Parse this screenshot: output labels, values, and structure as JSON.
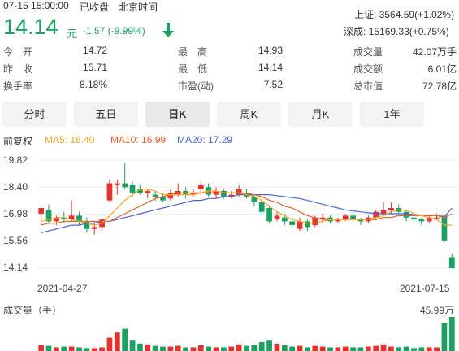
{
  "header": {
    "datetime": "07-15 15:00:00",
    "status": "已收盘",
    "timezone": "北京时间",
    "price": "14.14",
    "currency": "元",
    "change": "-1.57 (-9.99%)",
    "direction_icon": "arrow-down-icon"
  },
  "indices": [
    {
      "label": "上证:",
      "value": "3564.59(+1.02%)"
    },
    {
      "label": "深成:",
      "value": "15169.33(+0.75%)"
    }
  ],
  "stats": {
    "col1": [
      {
        "label": "今　开",
        "value": "14.72"
      },
      {
        "label": "昨　收",
        "value": "15.71"
      },
      {
        "label": "换手率",
        "value": "8.18%"
      }
    ],
    "col2": [
      {
        "label": "最　高",
        "value": "14.93"
      },
      {
        "label": "最　低",
        "value": "14.14"
      },
      {
        "label": "市盈(动)",
        "value": "7.52"
      }
    ],
    "col3": [
      {
        "label": "成交量",
        "value": "42.07万手"
      },
      {
        "label": "成交额",
        "value": "6.01亿"
      },
      {
        "label": "总市值",
        "value": "72.78亿"
      }
    ]
  },
  "tabs": [
    "分时",
    "五日",
    "日K",
    "周K",
    "月K",
    "1年"
  ],
  "active_tab": "日K",
  "ma_bar": {
    "adjust": "前复权",
    "ma5": "MA5: 16.40",
    "ma10": "MA10: 16.99",
    "ma20": "MA20: 17.29"
  },
  "colors": {
    "up": "#e5322d",
    "down": "#1aa260",
    "ma5": "#f5a623",
    "ma10": "#e8622b",
    "ma20": "#4a63d8"
  },
  "volume_label": "成交量（手）",
  "volume_max_label": "45.99万",
  "chart_data": {
    "type": "candlestick",
    "y_ticks": [
      "19.82",
      "18.40",
      "16.98",
      "15.56",
      "14.14"
    ],
    "x_labels": [
      "2021-04-27",
      "2021-07-15"
    ],
    "ylim": [
      14.14,
      19.82
    ],
    "candles": [
      {
        "o": 17.0,
        "c": 17.3,
        "h": 17.4,
        "l": 16.4
      },
      {
        "o": 17.2,
        "c": 16.6,
        "h": 17.5,
        "l": 16.5
      },
      {
        "o": 16.6,
        "c": 16.8,
        "h": 16.9,
        "l": 16.4
      },
      {
        "o": 16.8,
        "c": 16.7,
        "h": 17.1,
        "l": 16.5
      },
      {
        "o": 16.7,
        "c": 16.9,
        "h": 17.7,
        "l": 16.6
      },
      {
        "o": 16.9,
        "c": 16.6,
        "h": 17.1,
        "l": 16.4
      },
      {
        "o": 16.6,
        "c": 16.2,
        "h": 16.8,
        "l": 16.0
      },
      {
        "o": 16.2,
        "c": 16.3,
        "h": 16.6,
        "l": 15.9
      },
      {
        "o": 16.3,
        "c": 16.7,
        "h": 16.8,
        "l": 16.1
      },
      {
        "o": 17.7,
        "c": 18.6,
        "h": 18.8,
        "l": 17.6
      },
      {
        "o": 18.5,
        "c": 18.6,
        "h": 18.8,
        "l": 18.0
      },
      {
        "o": 18.6,
        "c": 18.4,
        "h": 19.7,
        "l": 18.3
      },
      {
        "o": 18.5,
        "c": 18.1,
        "h": 18.7,
        "l": 17.9
      },
      {
        "o": 18.3,
        "c": 18.1,
        "h": 18.5,
        "l": 18.0
      },
      {
        "o": 18.1,
        "c": 18.2,
        "h": 18.3,
        "l": 17.8
      },
      {
        "o": 18.0,
        "c": 17.9,
        "h": 18.2,
        "l": 17.7
      },
      {
        "o": 17.9,
        "c": 17.7,
        "h": 18.1,
        "l": 17.6
      },
      {
        "o": 17.8,
        "c": 18.1,
        "h": 18.3,
        "l": 17.7
      },
      {
        "o": 18.0,
        "c": 18.2,
        "h": 18.6,
        "l": 17.9
      },
      {
        "o": 18.2,
        "c": 18.0,
        "h": 18.4,
        "l": 17.8
      },
      {
        "o": 18.0,
        "c": 18.1,
        "h": 18.3,
        "l": 17.9
      },
      {
        "o": 18.3,
        "c": 18.5,
        "h": 18.7,
        "l": 18.0
      },
      {
        "o": 18.4,
        "c": 18.0,
        "h": 18.6,
        "l": 17.9
      },
      {
        "o": 18.0,
        "c": 18.2,
        "h": 18.4,
        "l": 17.8
      },
      {
        "o": 18.2,
        "c": 17.9,
        "h": 18.3,
        "l": 17.8
      },
      {
        "o": 17.9,
        "c": 18.0,
        "h": 18.2,
        "l": 17.8
      },
      {
        "o": 18.0,
        "c": 18.3,
        "h": 18.5,
        "l": 17.9
      },
      {
        "o": 18.1,
        "c": 17.9,
        "h": 18.3,
        "l": 17.8
      },
      {
        "o": 17.9,
        "c": 17.6,
        "h": 18.0,
        "l": 17.4
      },
      {
        "o": 17.6,
        "c": 17.1,
        "h": 17.8,
        "l": 17.0
      },
      {
        "o": 17.3,
        "c": 16.6,
        "h": 17.4,
        "l": 16.5
      },
      {
        "o": 16.7,
        "c": 16.9,
        "h": 17.1,
        "l": 16.6
      },
      {
        "o": 16.8,
        "c": 16.6,
        "h": 17.0,
        "l": 16.4
      },
      {
        "o": 16.6,
        "c": 16.4,
        "h": 16.8,
        "l": 16.3
      },
      {
        "o": 16.2,
        "c": 16.6,
        "h": 16.8,
        "l": 16.1
      },
      {
        "o": 16.6,
        "c": 16.3,
        "h": 16.7,
        "l": 16.1
      },
      {
        "o": 16.4,
        "c": 16.8,
        "h": 16.9,
        "l": 16.3
      },
      {
        "o": 16.7,
        "c": 16.8,
        "h": 17.0,
        "l": 16.5
      },
      {
        "o": 16.8,
        "c": 16.6,
        "h": 16.9,
        "l": 16.5
      },
      {
        "o": 16.6,
        "c": 16.7,
        "h": 16.8,
        "l": 16.5
      },
      {
        "o": 16.7,
        "c": 16.9,
        "h": 17.0,
        "l": 16.6
      },
      {
        "o": 16.9,
        "c": 16.7,
        "h": 17.1,
        "l": 16.6
      },
      {
        "o": 16.7,
        "c": 16.6,
        "h": 16.8,
        "l": 16.4
      },
      {
        "o": 16.6,
        "c": 16.8,
        "h": 16.9,
        "l": 16.5
      },
      {
        "o": 16.8,
        "c": 17.1,
        "h": 17.2,
        "l": 16.7
      },
      {
        "o": 17.0,
        "c": 17.2,
        "h": 17.6,
        "l": 16.9
      },
      {
        "o": 17.2,
        "c": 17.3,
        "h": 17.6,
        "l": 17.0
      },
      {
        "o": 17.3,
        "c": 17.1,
        "h": 17.5,
        "l": 17.0
      },
      {
        "o": 17.1,
        "c": 16.8,
        "h": 17.2,
        "l": 16.6
      },
      {
        "o": 16.8,
        "c": 16.7,
        "h": 16.9,
        "l": 16.6
      },
      {
        "o": 16.7,
        "c": 16.6,
        "h": 16.8,
        "l": 16.4
      },
      {
        "o": 16.6,
        "c": 16.8,
        "h": 16.9,
        "l": 16.5
      },
      {
        "o": 16.8,
        "c": 16.8,
        "h": 17.0,
        "l": 16.7
      },
      {
        "o": 16.9,
        "c": 15.6,
        "h": 15.8,
        "l": 15.5
      },
      {
        "o": 14.72,
        "c": 14.14,
        "h": 14.93,
        "l": 14.14
      }
    ],
    "ma5": [
      16.6,
      16.7,
      16.8,
      16.8,
      16.7,
      16.6,
      16.5,
      16.4,
      16.5,
      16.9,
      17.3,
      17.7,
      18.0,
      18.3,
      18.3,
      18.2,
      18.0,
      18.0,
      18.0,
      18.0,
      18.0,
      18.1,
      18.2,
      18.2,
      18.1,
      18.1,
      18.1,
      18.0,
      17.9,
      17.7,
      17.4,
      17.1,
      16.9,
      16.7,
      16.6,
      16.5,
      16.5,
      16.6,
      16.7,
      16.7,
      16.7,
      16.7,
      16.7,
      16.7,
      16.8,
      16.9,
      17.1,
      17.2,
      17.2,
      17.0,
      16.9,
      16.8,
      16.7,
      16.4,
      16.4
    ],
    "ma10": [
      16.4,
      16.5,
      16.5,
      16.6,
      16.6,
      16.6,
      16.6,
      16.6,
      16.6,
      16.6,
      16.8,
      17.0,
      17.2,
      17.4,
      17.6,
      17.8,
      17.9,
      18.0,
      18.1,
      18.1,
      18.1,
      18.1,
      18.1,
      18.1,
      18.1,
      18.1,
      18.1,
      18.1,
      18.0,
      17.9,
      17.7,
      17.6,
      17.4,
      17.3,
      17.1,
      16.9,
      16.8,
      16.7,
      16.7,
      16.7,
      16.7,
      16.7,
      16.7,
      16.7,
      16.7,
      16.8,
      16.8,
      16.9,
      16.9,
      16.9,
      16.9,
      16.9,
      16.9,
      16.8,
      16.99
    ],
    "ma20": [
      16.0,
      16.1,
      16.2,
      16.3,
      16.4,
      16.4,
      16.5,
      16.5,
      16.6,
      16.6,
      16.7,
      16.8,
      16.9,
      17.0,
      17.1,
      17.2,
      17.3,
      17.4,
      17.5,
      17.6,
      17.7,
      17.7,
      17.8,
      17.8,
      17.9,
      17.9,
      18.0,
      18.0,
      18.0,
      18.0,
      18.0,
      17.95,
      17.9,
      17.85,
      17.8,
      17.7,
      17.6,
      17.5,
      17.4,
      17.3,
      17.2,
      17.15,
      17.1,
      17.05,
      17.0,
      17.0,
      17.0,
      17.0,
      17.0,
      16.95,
      16.9,
      16.9,
      16.9,
      16.85,
      17.29
    ],
    "volumes": [
      8,
      7,
      5,
      6,
      6,
      5,
      4,
      4,
      5,
      18,
      25,
      30,
      14,
      10,
      9,
      7,
      6,
      6,
      7,
      5,
      5,
      8,
      6,
      5,
      5,
      6,
      9,
      7,
      8,
      12,
      14,
      10,
      8,
      6,
      7,
      5,
      7,
      6,
      5,
      5,
      6,
      5,
      5,
      6,
      7,
      9,
      6,
      5,
      6,
      4,
      5,
      5,
      5,
      38,
      46
    ],
    "volume_max": 46
  }
}
